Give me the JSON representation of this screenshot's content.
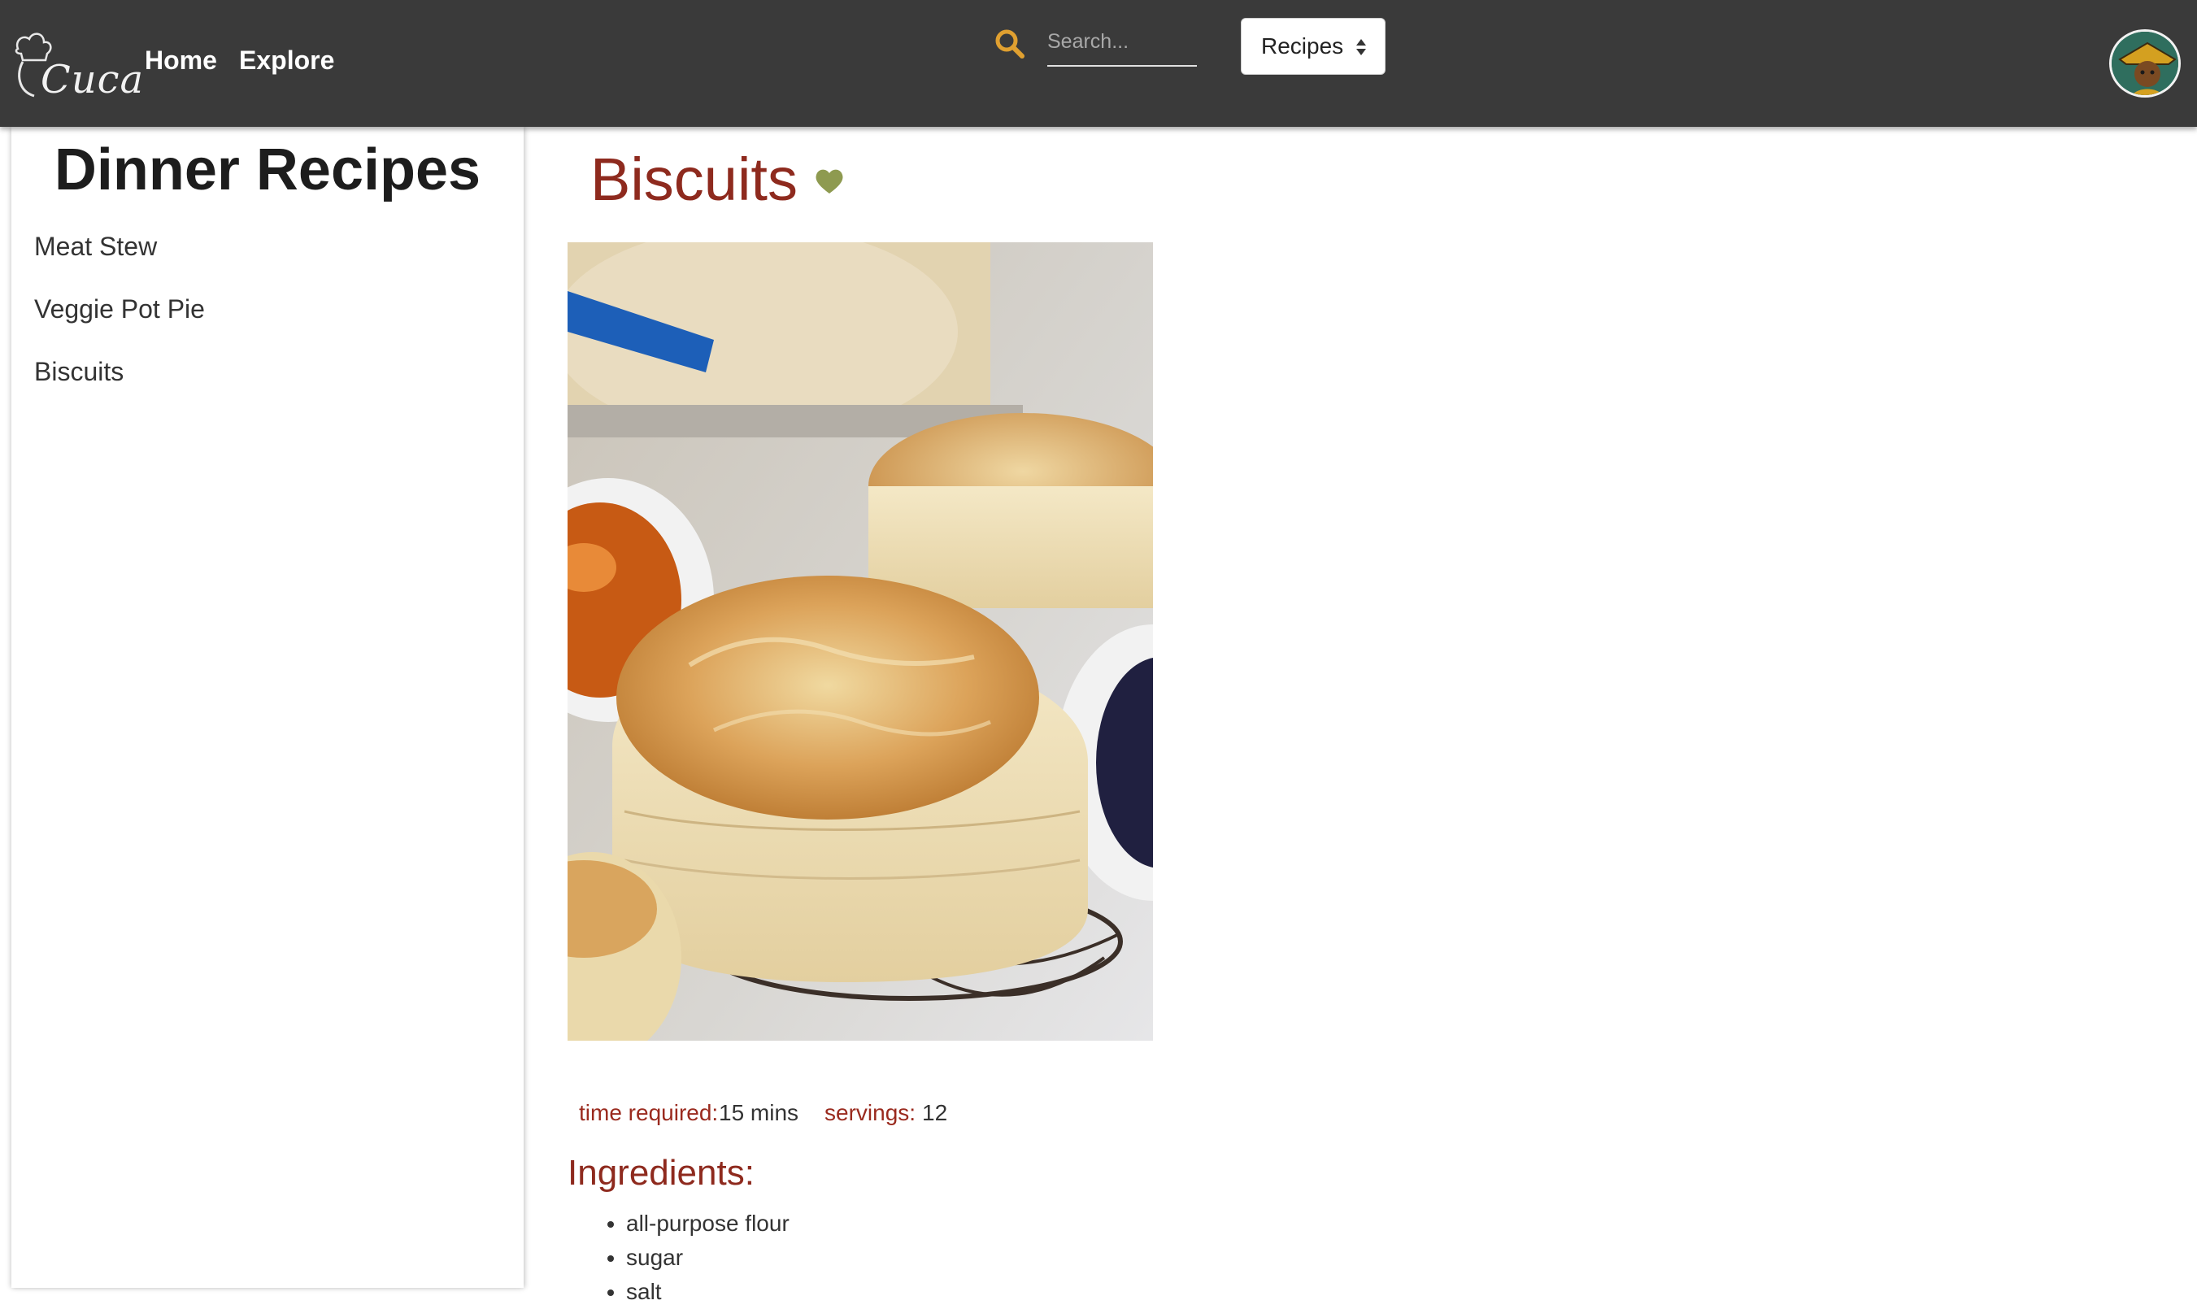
{
  "nav": {
    "brand": "Cuca",
    "home_label": "Home",
    "explore_label": "Explore"
  },
  "search": {
    "placeholder": "Search..."
  },
  "category_select": {
    "selected": "Recipes"
  },
  "sidebar": {
    "title": "Dinner Recipes",
    "items": [
      {
        "label": "Meat Stew"
      },
      {
        "label": "Veggie Pot Pie"
      },
      {
        "label": "Biscuits"
      }
    ]
  },
  "recipe": {
    "title": "Biscuits",
    "time_label": "time required:",
    "time_value": "15 mins",
    "servings_label": "servings:",
    "servings_value": "12",
    "ingredients_heading": "Ingredients:",
    "ingredients": [
      "all-purpose flour",
      "sugar",
      "salt"
    ]
  },
  "icons": {
    "search": "search-icon",
    "favorite": "heart-icon",
    "select_caret": "sort-caret-icon"
  },
  "colors": {
    "navbar_bg": "#3a3a3a",
    "accent_red": "#8e2a1e",
    "search_icon": "#e0a030",
    "heart": "#8e9a50"
  }
}
